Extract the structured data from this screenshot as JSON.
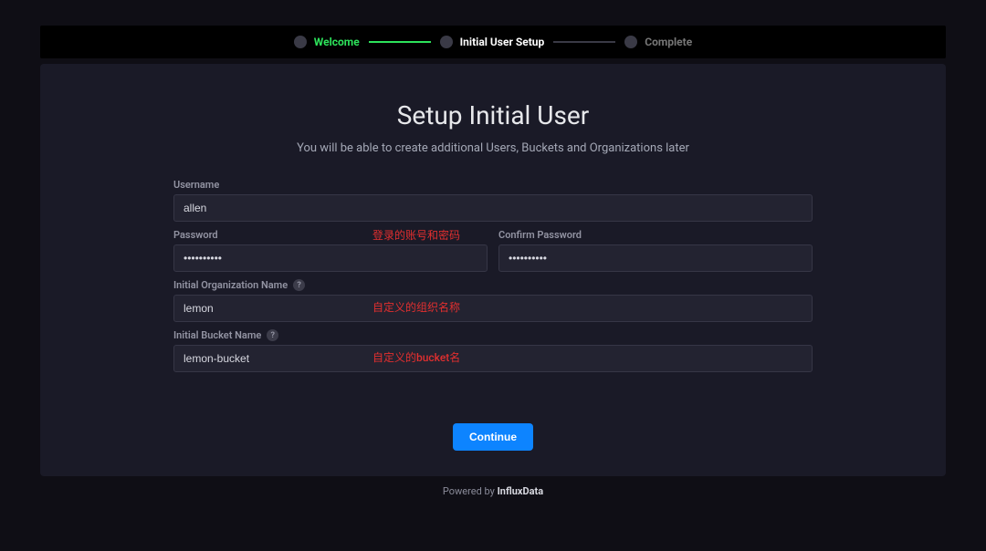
{
  "stepper": {
    "steps": [
      {
        "label": "Welcome",
        "state": "done"
      },
      {
        "label": "Initial User Setup",
        "state": "active"
      },
      {
        "label": "Complete",
        "state": "pending"
      }
    ]
  },
  "page": {
    "title": "Setup Initial User",
    "subtitle": "You will be able to create additional Users, Buckets and Organizations later"
  },
  "form": {
    "username": {
      "label": "Username",
      "value": "allen"
    },
    "password": {
      "label": "Password",
      "value": "••••••••••"
    },
    "confirm": {
      "label": "Confirm Password",
      "value": "••••••••••"
    },
    "org": {
      "label": "Initial Organization Name",
      "value": "lemon"
    },
    "bucket": {
      "label": "Initial Bucket Name",
      "value": "lemon-bucket"
    }
  },
  "annotations": {
    "creds": "登录的账号和密码",
    "org": "自定义的组织名称",
    "bucket": "自定义的bucket名"
  },
  "actions": {
    "continue": "Continue"
  },
  "footer": {
    "prefix": "Powered by ",
    "brand": "InfluxData"
  },
  "help_glyph": "?"
}
